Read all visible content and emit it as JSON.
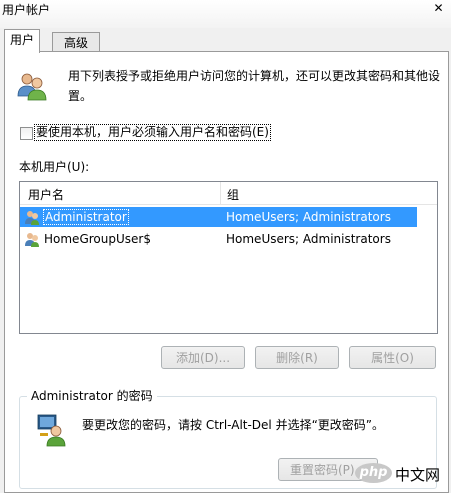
{
  "window": {
    "title": "用户帐户",
    "close_glyph": "✕"
  },
  "tabs": [
    {
      "label": "用户"
    },
    {
      "label": "高级"
    }
  ],
  "intro_text": "用下列表授予或拒绝用户访问您的计算机，还可以更改其密码和其他设置。",
  "require_login": {
    "label": "要使用本机，用户必须输入用户名和密码(E)",
    "checked": false
  },
  "local_users_label": "本机用户(U):",
  "users_table": {
    "columns": [
      "用户名",
      "组"
    ],
    "rows": [
      {
        "name": "Administrator",
        "group": "HomeUsers; Administrators",
        "selected": true
      },
      {
        "name": "HomeGroupUser$",
        "group": "HomeUsers; Administrators",
        "selected": false
      }
    ]
  },
  "buttons": {
    "add": "添加(D)...",
    "remove": "删除(R)",
    "properties": "属性(O)"
  },
  "password_group": {
    "title": "Administrator 的密码",
    "text": "要更改您的密码，请按 Ctrl-Alt-Del 并选择“更改密码”。",
    "reset_button": "重置密码(P)..."
  },
  "watermark": {
    "logo": "php",
    "text": "中文网"
  },
  "icons": {
    "users": "users-icon",
    "user_row": "user-icon",
    "password": "user-key-icon",
    "close": "close-icon"
  },
  "colors": {
    "selection": "#3399ff",
    "window_bg": "#f0f0f0"
  }
}
